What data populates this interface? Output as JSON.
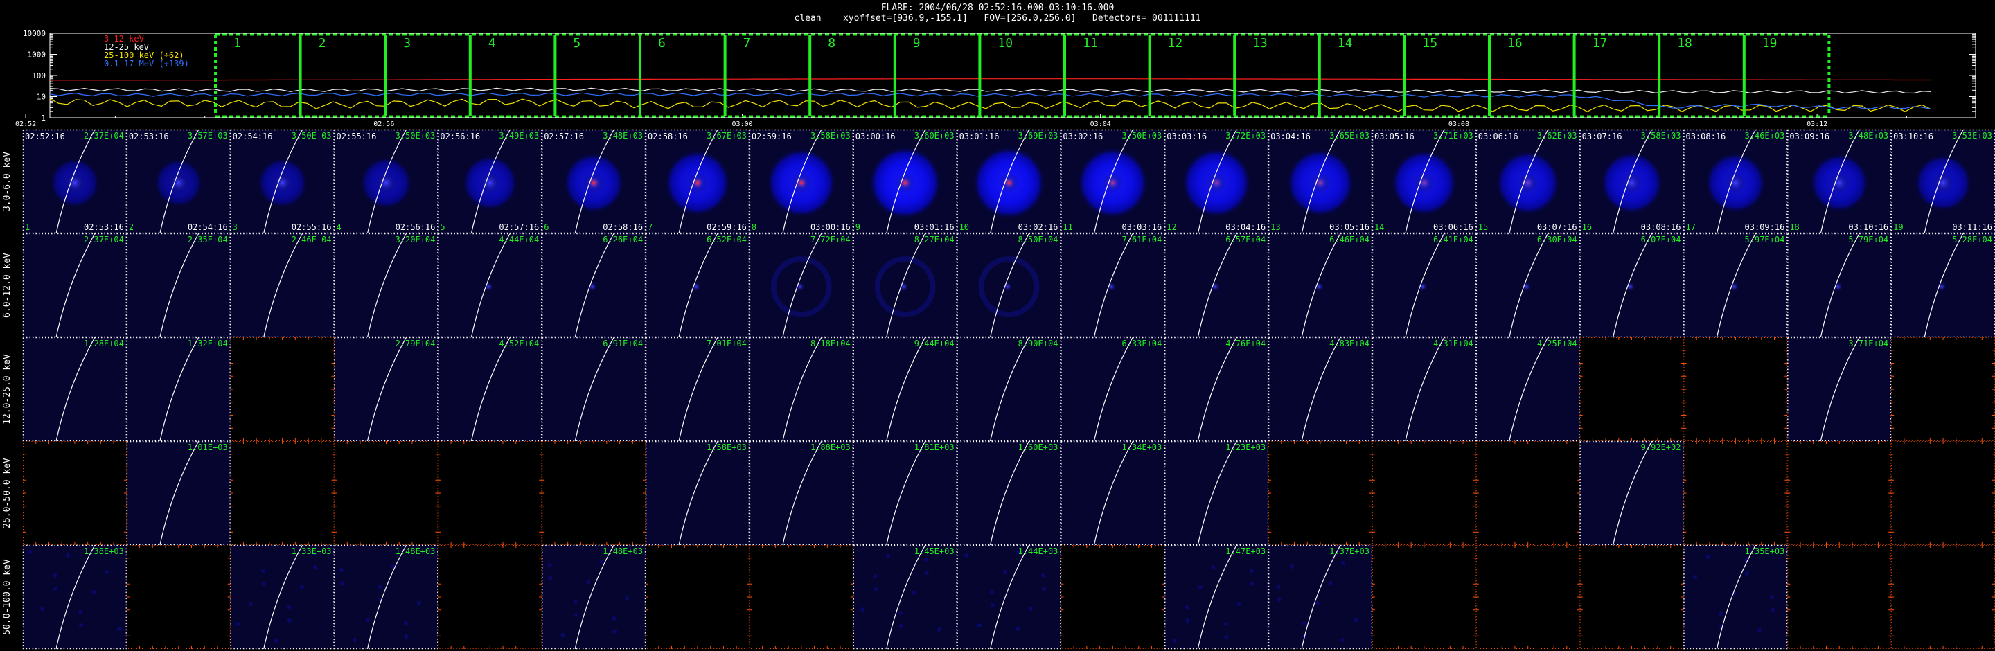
{
  "header": {
    "line1": "FLARE: 2004/06/28 02:52:16.000-03:10:16.000",
    "line2": "clean    xyoffset=[936.9,-155.1]   FOV=[256.0,256.0]   Detectors= 001111111"
  },
  "lightcurve": {
    "legend": [
      {
        "label": "3-12 keV",
        "color": "#ff2020"
      },
      {
        "label": "12-25 keV",
        "color": "#f0f0f0"
      },
      {
        "label": "25-100 keV (÷62)",
        "color": "#f0e000"
      },
      {
        "label": "0.1-17 MeV (÷139)",
        "color": "#3070ff"
      }
    ],
    "y_ticks": [
      "10000",
      "1000",
      "100",
      "10",
      "1"
    ],
    "x_ticks": [
      "02:52",
      "02:56",
      "03:00",
      "03:04",
      "03:08",
      "03:12"
    ],
    "interval_labels": [
      "1",
      "2",
      "3",
      "4",
      "5",
      "6",
      "7",
      "8",
      "9",
      "10",
      "11",
      "12",
      "13",
      "14",
      "15",
      "16",
      "17",
      "18",
      "19"
    ]
  },
  "colors": {
    "background": "#000000",
    "panel_dark": "#050530",
    "grid_dots": "#ffffff",
    "empty_border": "#ff5000",
    "green": "#22ee22",
    "limb": "#ffffff",
    "source_blue": "#2020ff",
    "source_red": "#ff2020"
  },
  "grid": {
    "start_times": [
      "02:52:16",
      "02:53:16",
      "02:54:16",
      "02:55:16",
      "02:56:16",
      "02:57:16",
      "02:58:16",
      "02:59:16",
      "03:00:16",
      "03:01:16",
      "03:02:16",
      "03:03:16",
      "03:04:16",
      "03:05:16",
      "03:06:16",
      "03:07:16",
      "03:08:16",
      "03:09:16",
      "03:10:16"
    ],
    "end_times": [
      "02:53:16",
      "02:54:16",
      "02:55:16",
      "02:56:16",
      "02:57:16",
      "02:58:16",
      "02:59:16",
      "03:00:16",
      "03:01:16",
      "03:02:16",
      "03:03:16",
      "03:04:16",
      "03:05:16",
      "03:06:16",
      "03:07:16",
      "03:08:16",
      "03:09:16",
      "03:10:16",
      "03:11:16"
    ],
    "rows": [
      {
        "label": "3.0-6.0 keV",
        "peaks": [
          "2.37E+04",
          "3.57E+03",
          "3.50E+03",
          "3.50E+03",
          "3.49E+03",
          "3.48E+03",
          "3.67E+03",
          "3.58E+03",
          "3.60E+03",
          "3.69E+03",
          "3.50E+03",
          "3.72E+03",
          "3.65E+03",
          "3.71E+03",
          "3.62E+03",
          "3.58E+03",
          "3.46E+03",
          "3.48E+03",
          "3.53E+03"
        ],
        "glow": [
          0.28,
          0.25,
          0.3,
          0.35,
          0.45,
          0.6,
          0.75,
          0.85,
          0.95,
          0.95,
          0.9,
          0.85,
          0.8,
          0.75,
          0.7,
          0.65,
          0.6,
          0.55,
          0.5
        ],
        "red": [
          0,
          0,
          0,
          0,
          0,
          1,
          1,
          1,
          1,
          1,
          0.6,
          0.5,
          0.5,
          0.4,
          0.3,
          0,
          0,
          0,
          0
        ]
      },
      {
        "label": "6.0-12.0 keV",
        "peaks": [
          "2.37E+04",
          "2.35E+04",
          "2.46E+04",
          "3.20E+04",
          "4.44E+04",
          "6.26E+04",
          "6.52E+04",
          "7.72E+04",
          "8.27E+04",
          "8.50E+04",
          "7.61E+04",
          "6.57E+04",
          "6.46E+04",
          "6.41E+04",
          "6.30E+04",
          "6.07E+04",
          "5.97E+04",
          "5.79E+04",
          "5.28E+04"
        ]
      },
      {
        "label": "12.0-25.0 keV",
        "peaks": [
          "1.28E+04",
          "1.32E+04",
          "",
          "2.79E+04",
          "4.52E+04",
          "6.91E+04",
          "7.01E+04",
          "8.18E+04",
          "9.44E+04",
          "8.90E+04",
          "6.33E+04",
          "4.76E+04",
          "4.83E+04",
          "4.31E+04",
          "4.25E+04",
          "",
          "",
          "3.71E+04",
          ""
        ]
      },
      {
        "label": "25.0-50.0 keV",
        "peaks": [
          "",
          "1.01E+03",
          "",
          "",
          "",
          "",
          "1.58E+03",
          "1.88E+03",
          "1.81E+03",
          "1.60E+03",
          "1.34E+03",
          "1.23E+03",
          "",
          "",
          "",
          "9.92E+02",
          "",
          "",
          ""
        ]
      },
      {
        "label": "50.0-100.0 keV",
        "peaks": [
          "1.38E+03",
          "",
          "1.33E+03",
          "1.48E+03",
          "",
          "1.48E+03",
          "",
          "",
          "1.45E+03",
          "1.44E+03",
          "",
          "1.47E+03",
          "1.37E+03",
          "",
          "",
          "",
          "1.35E+03",
          "",
          ""
        ]
      }
    ]
  },
  "chart_data": {
    "type": "line",
    "title": "FLARE: 2004/06/28 02:52:16.000-03:10:16.000",
    "x": [
      "02:52",
      "02:53",
      "02:54",
      "02:55",
      "02:56",
      "02:57",
      "02:58",
      "02:59",
      "03:00",
      "03:01",
      "03:02",
      "03:03",
      "03:04",
      "03:05",
      "03:06",
      "03:07",
      "03:08",
      "03:09",
      "03:10",
      "03:11",
      "03:12",
      "03:13"
    ],
    "y_scale": "log",
    "ylim": [
      1,
      10000
    ],
    "series": [
      {
        "name": "3-12 keV",
        "values": [
          60,
          60,
          61,
          62,
          63,
          65,
          66,
          67,
          68,
          69,
          70,
          70,
          70,
          69,
          68,
          67,
          66,
          65,
          64,
          63,
          62,
          61
        ]
      },
      {
        "name": "12-25 keV",
        "values": [
          22,
          21,
          20,
          20,
          21,
          22,
          22,
          21,
          21,
          20,
          20,
          20,
          19,
          19,
          19,
          18,
          18,
          18,
          17,
          17,
          17,
          16
        ]
      },
      {
        "name": "25-100 keV (÷62)",
        "values": [
          6,
          5,
          5,
          4,
          5,
          6,
          5,
          4,
          5,
          5,
          4,
          4,
          5,
          4,
          4,
          3,
          3,
          3,
          3,
          3,
          3,
          3
        ]
      },
      {
        "name": "0.1-17 MeV (÷139)",
        "values": [
          13,
          12,
          12,
          13,
          13,
          13,
          13,
          13,
          13,
          13,
          12,
          12,
          12,
          12,
          12,
          11,
          11,
          11,
          3,
          4,
          3,
          3
        ]
      }
    ]
  }
}
